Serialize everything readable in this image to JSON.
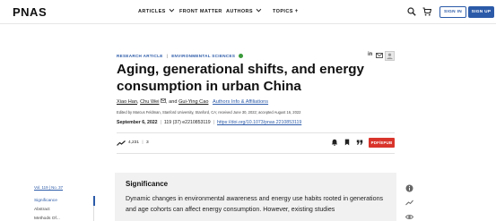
{
  "brand": {
    "logo": "PNAS"
  },
  "nav": {
    "items": [
      {
        "label": "ARTICLES",
        "has_dropdown": true
      },
      {
        "label": "FRONT MATTER",
        "has_dropdown": false
      },
      {
        "label": "AUTHORS",
        "has_dropdown": true
      },
      {
        "label": "TOPICS",
        "has_plus": true
      }
    ],
    "sign_in": "SIGN IN",
    "sign_up": "SIGN UP"
  },
  "article": {
    "type": "RESEARCH ARTICLE",
    "category": "ENVIRONMENTAL SCIENCES",
    "title": "Aging, generational shifts, and energy consumption in urban China",
    "authors": [
      "Xiao Han",
      "Chu Wei",
      "Gui-Ying Cao"
    ],
    "author_join": ", and",
    "authors_link": "Authors Info & Affiliations",
    "edited_by": "Edited by Marcus Feldman, Stanford University, Stanford, CA; received June 30, 2022; accepted August 16, 2022",
    "date": "September 6, 2022",
    "citation": "119 (37) e2210853119",
    "doi": "https://doi.org/10.1073/pnas.2210853119"
  },
  "metrics": {
    "views": "4,231",
    "citations": "3"
  },
  "pdf_label": "PDF/EPUB",
  "toc": {
    "issue": "Vol. 119 | No. 37",
    "items": [
      "Significance",
      "Abstract",
      "Methods Of..."
    ]
  },
  "significance": {
    "heading": "Significance",
    "body": "Dynamic changes in environmental awareness and energy use habits rooted in generations and age cohorts can affect energy consumption. However, existing studies"
  },
  "colors": {
    "accent": "#2b5aa8",
    "pdf": "#d9342b",
    "box": "#f1f1f1"
  },
  "icons": [
    "search-icon",
    "cart-icon",
    "linkedin-icon",
    "email-icon",
    "trend-icon",
    "alert-icon",
    "bookmark-icon",
    "quote-icon",
    "info-icon",
    "eye-icon"
  ]
}
